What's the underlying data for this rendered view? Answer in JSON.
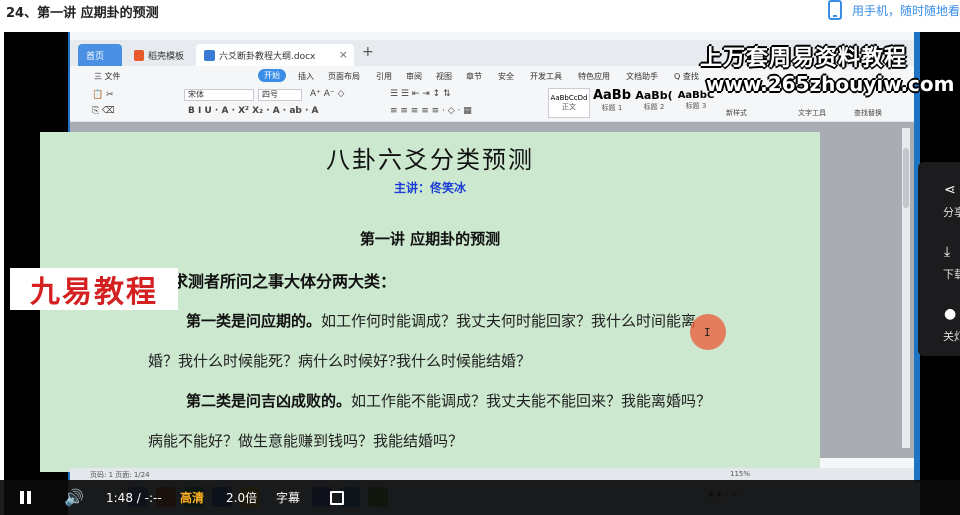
{
  "page": {
    "title": "24、第一讲 应期卦的预测",
    "mobile_link": "用手机，随时随地看"
  },
  "wps": {
    "tabs": {
      "home": "首页",
      "store": "稻壳模板",
      "document": "六爻断卦教程大纲.docx"
    },
    "menu": {
      "file": "三 文件",
      "items": [
        "开始",
        "插入",
        "页面布局",
        "引用",
        "审阅",
        "视图",
        "章节",
        "安全",
        "开发工具",
        "特色应用",
        "文档助手",
        "Q 查找"
      ]
    },
    "ribbon": {
      "font": "宋体",
      "size": "四号",
      "styles": [
        {
          "sample": "AaBbCcDd",
          "name": "正文"
        },
        {
          "sample": "AaBb",
          "name": "标题 1"
        },
        {
          "sample": "AaBb(",
          "name": "标题 2"
        },
        {
          "sample": "AaBbC",
          "name": "标题 3"
        }
      ],
      "new_style": "新样式",
      "text_tools": "文字工具",
      "find_replace": "查找替换"
    },
    "status_bar": {
      "page": "页码: 1  页面: 1/24",
      "zoom": "115%"
    }
  },
  "document": {
    "title": "八卦六爻分类预测",
    "lecturer": "主讲：佟笑冰",
    "lecture": "第一讲  应期卦的预测",
    "section": "一、按求测者所问之事大体分两大类：",
    "para1_bold": "第一类是问应期的。",
    "para1_text": "如工作何时能调成？我丈夫何时能回家？我什么时间能离",
    "para1_line2": "婚？我什么时候能死？病什么时候好?我什么时候能结婚？",
    "para2_bold": "第二类是问吉凶成败的。",
    "para2_text": "如工作能不能调成？我丈夫能不能回来？我能离婚吗？",
    "para2_line2": "病能不能好？做生意能赚到钱吗？我能结婚吗？",
    "cursor_glyph": "I"
  },
  "watermarks": {
    "title": "上万套周易资料教程",
    "url": "www.265zhouyiw.com",
    "brand": "九易教程"
  },
  "side_panel": {
    "share": "分享",
    "download": "下载",
    "turn_off_light": "关灯"
  },
  "controls": {
    "time": "1:48 / -:--",
    "quality": "高清",
    "speed": "2.0倍",
    "subtitle": "字幕"
  },
  "colors": {
    "accent_blue": "#3a8ee6",
    "page_green": "#cce8cf",
    "lecturer_blue": "#1b3bd8",
    "brand_red": "#d42020",
    "quality_orange": "#ffb020"
  }
}
